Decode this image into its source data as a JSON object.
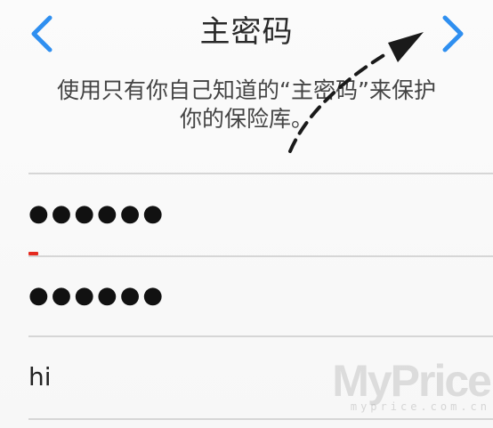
{
  "nav": {
    "title": "主密码",
    "back_icon": "chevron-left-icon",
    "next_icon": "chevron-right-icon",
    "accent_color": "#2f8ff0"
  },
  "instruction": {
    "line1": "使用只有你自己知道的“主密码”来保护",
    "line2": "你的保险库。"
  },
  "form": {
    "password": "●●●●●●",
    "confirm_password": "●●●●●●",
    "hint": "hi",
    "strength_color": "#e52a1f"
  },
  "overlay": {
    "arrow_icon": "dashed-arrow-icon"
  },
  "watermark": {
    "logo": "MyPrice",
    "url": "myprice.com.cn"
  }
}
